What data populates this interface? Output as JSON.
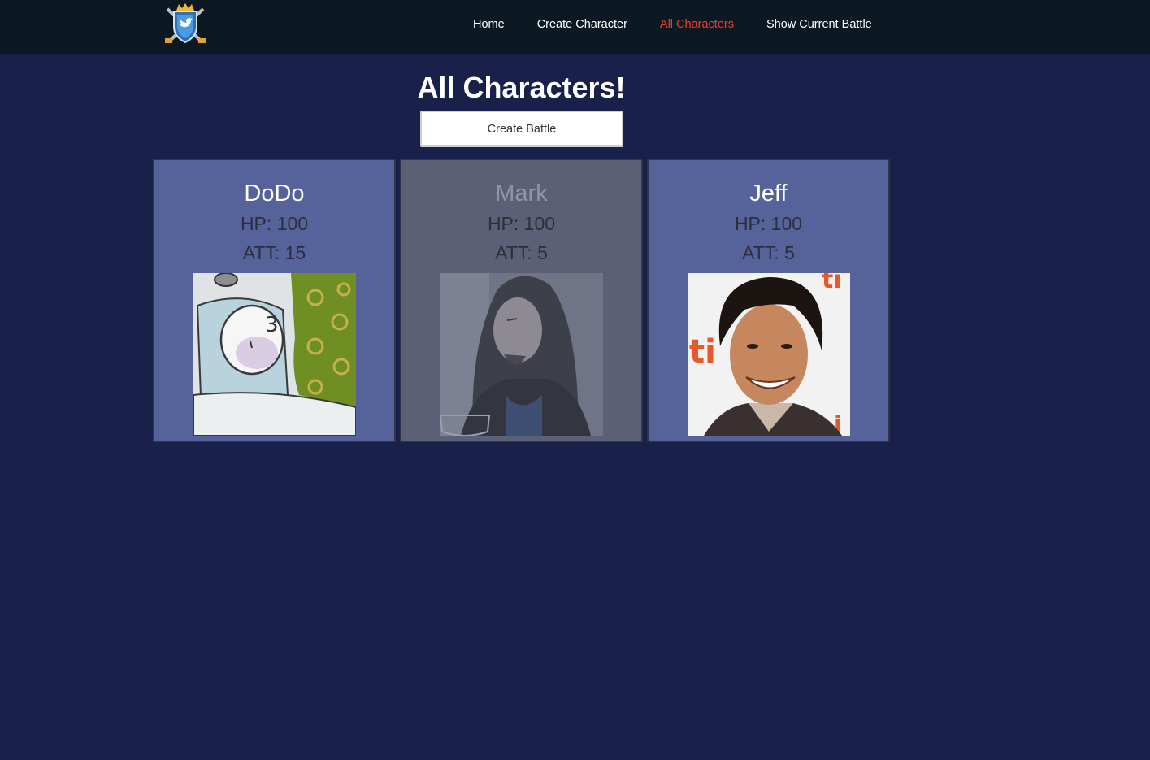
{
  "nav": {
    "logo": "shield-crown-logo",
    "links": [
      {
        "label": "Home",
        "active": false
      },
      {
        "label": "Create Character",
        "active": false
      },
      {
        "label": "All Characters",
        "active": true
      },
      {
        "label": "Show Current Battle",
        "active": false
      }
    ]
  },
  "page": {
    "title": "All Characters!",
    "create_battle_label": "Create Battle"
  },
  "characters": [
    {
      "name": "DoDo",
      "hp": "HP: 100",
      "att": "ATT: 15",
      "image": "sleeping-cartoon-cat",
      "dimmed": false
    },
    {
      "name": "Mark",
      "hp": "HP: 100",
      "att": "ATT: 5",
      "image": "man-in-hoodie-photo",
      "dimmed": true
    },
    {
      "name": "Jeff",
      "hp": "HP: 100",
      "att": "ATT: 5",
      "image": "smiling-man-photo",
      "dimmed": false
    }
  ],
  "colors": {
    "background": "#19204a",
    "navbar": "#0c1922",
    "active_link": "#e8402e",
    "card": "#56629a",
    "card_dimmed": "#5b6076"
  }
}
